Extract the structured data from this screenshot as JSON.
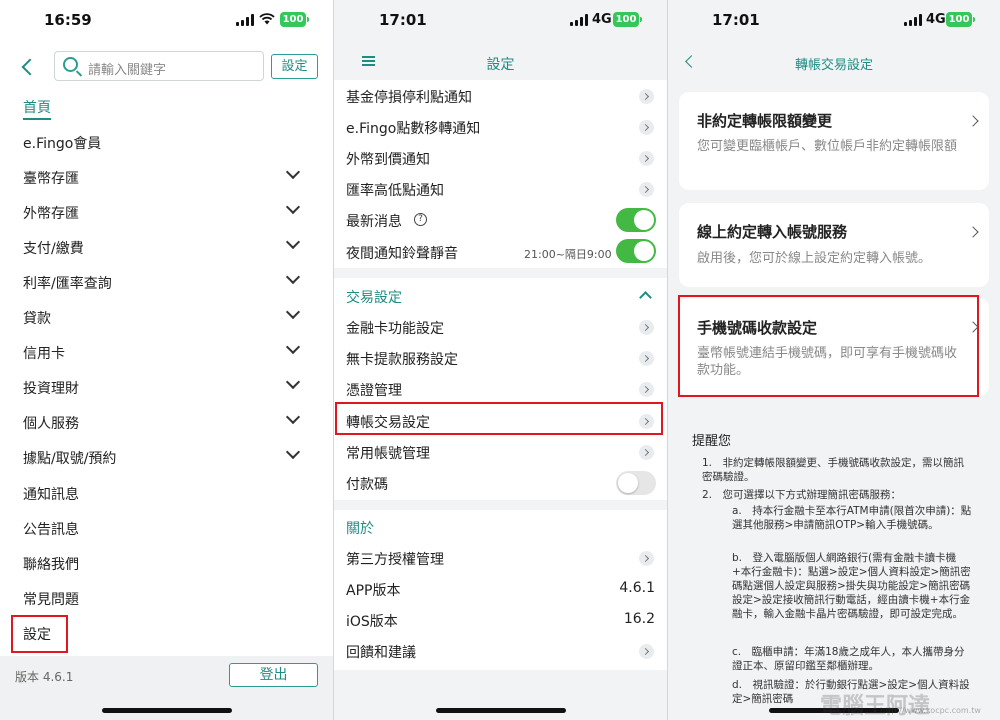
{
  "screen1": {
    "status": {
      "time": "16:59",
      "battery": "100"
    },
    "search_placeholder": "請輸入關鍵字",
    "settings_button": "設定",
    "menu": [
      {
        "label": "首頁",
        "active": true,
        "expandable": false
      },
      {
        "label": "e.Fingo會員",
        "expandable": false
      },
      {
        "label": "臺幣存匯",
        "expandable": true
      },
      {
        "label": "外幣存匯",
        "expandable": true
      },
      {
        "label": "支付/繳費",
        "expandable": true
      },
      {
        "label": "利率/匯率查詢",
        "expandable": true
      },
      {
        "label": "貸款",
        "expandable": true
      },
      {
        "label": "信用卡",
        "expandable": true
      },
      {
        "label": "投資理財",
        "expandable": true
      },
      {
        "label": "個人服務",
        "expandable": true
      },
      {
        "label": "據點/取號/預約",
        "expandable": true
      },
      {
        "label": "通知訊息",
        "expandable": false
      },
      {
        "label": "公告訊息",
        "expandable": false
      },
      {
        "label": "聯絡我們",
        "expandable": false
      },
      {
        "label": "常見問題",
        "expandable": false
      },
      {
        "label": "設定",
        "expandable": false,
        "highlighted": true
      }
    ],
    "version": "版本 4.6.1",
    "logout": "登出"
  },
  "screen2": {
    "status": {
      "time": "17:01",
      "network": "4G",
      "battery": "100"
    },
    "title": "設定",
    "notify_rows": [
      {
        "label": "基金停損停利點通知"
      },
      {
        "label": "e.Fingo點數移轉通知"
      },
      {
        "label": "外幣到價通知"
      },
      {
        "label": "匯率高低點通知"
      }
    ],
    "latest_news": "最新消息",
    "night_mute": "夜間通知鈴聲靜音",
    "night_mute_time": "21:00~隔日9:00",
    "trade_section": "交易設定",
    "trade_rows": [
      {
        "label": "金融卡功能設定"
      },
      {
        "label": "無卡提款服務設定"
      },
      {
        "label": "憑證管理"
      },
      {
        "label": "轉帳交易設定",
        "highlighted": true
      },
      {
        "label": "常用帳號管理"
      }
    ],
    "pay_code": "付款碼",
    "about_section": "關於",
    "third_party": "第三方授權管理",
    "app_version_label": "APP版本",
    "app_version_value": "4.6.1",
    "ios_version_label": "iOS版本",
    "ios_version_value": "16.2",
    "feedback": "回饋和建議",
    "colors": {
      "accent": "#1f8c82",
      "toggle_on": "#43b843",
      "highlight": "#e0171e"
    }
  },
  "screen3": {
    "status": {
      "time": "17:01",
      "network": "4G",
      "battery": "100"
    },
    "title": "轉帳交易設定",
    "cards": [
      {
        "title": "非約定轉帳限額變更",
        "desc": "您可變更臨櫃帳戶、數位帳戶非約定轉帳限額"
      },
      {
        "title": "線上約定轉入帳號服務",
        "desc": "啟用後，您可於線上設定約定轉入帳號。"
      },
      {
        "title": "手機號碼收款設定",
        "desc": "臺幣帳號連結手機號碼，即可享有手機號碼收款功能。",
        "highlighted": true
      }
    ],
    "remind_title": "提醒您",
    "notes": {
      "n1": "1.　非約定轉帳限額變更、手機號碼收款設定，需以簡訊密碼驗證。",
      "n2": "2.　您可選擇以下方式辦理簡訊密碼服務：",
      "a": "a.　持本行金融卡至本行ATM申請(限首次申請)：點選其他服務>申請簡訊OTP>輸入手機號碼。",
      "b": "b.　登入電腦版個人網路銀行(需有金融卡讀卡機+本行金融卡)：點選>設定>個人資料設定>簡訊密碼點選個人設定與服務>掛失與功能設定>簡訊密碼設定>設定接收簡訊行動電話，經由讀卡機+本行金融卡，輸入金融卡晶片密碼驗證，即可設定完成。",
      "c": "c.　臨櫃申請：年滿18歲之成年人，本人攜帶身分證正本、原留印鑑至鄰櫃辦理。",
      "d": "d.　視訊驗證：於行動銀行點選>設定>個人資料設定>簡訊密碼"
    },
    "watermark": "電腦王阿達",
    "watermark_url": "http://www.kocpc.com.tw"
  }
}
